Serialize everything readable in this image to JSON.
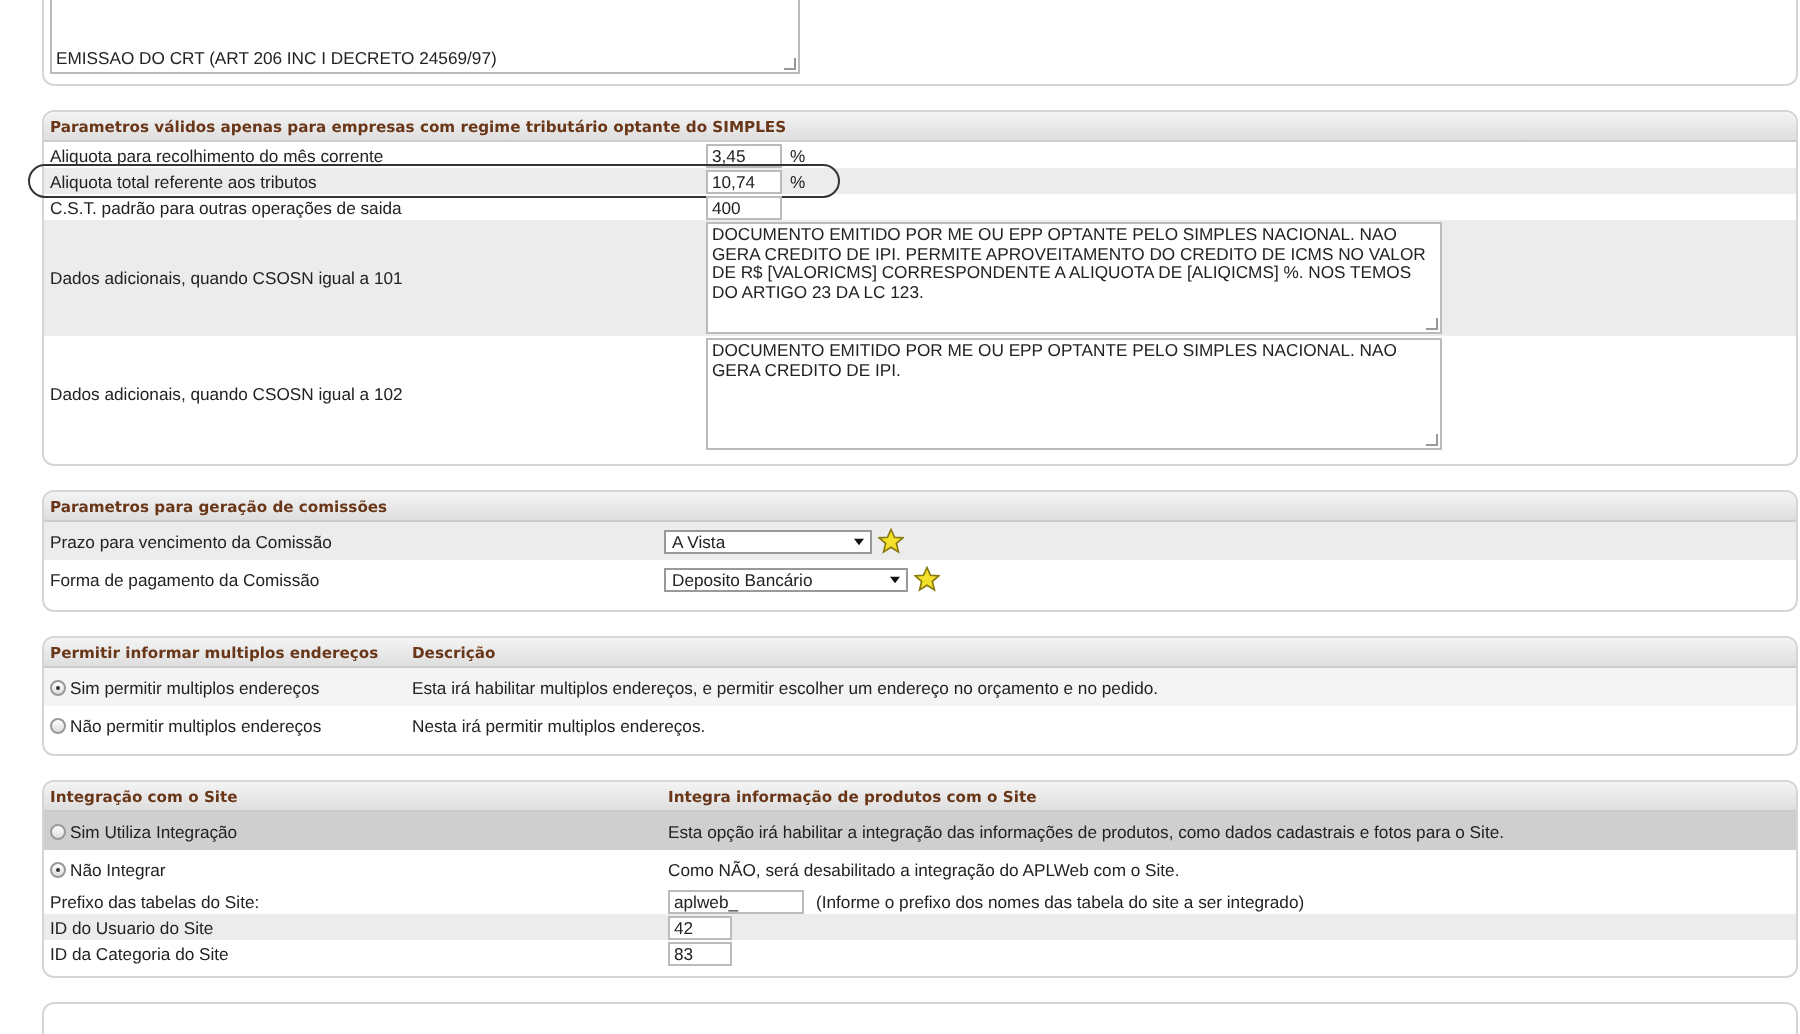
{
  "top_panel": {
    "textarea_value": "EMISSAO DO CRT (ART 206 INC I DECRETO 24569/97)"
  },
  "simples": {
    "title": "Parametros válidos apenas para empresas com regime tributário optante do SIMPLES",
    "rows": [
      {
        "kind": "input",
        "label": "Aliquota para recolhimento do mês corrente",
        "value": "3,45",
        "unit": "%",
        "circled": false
      },
      {
        "kind": "input",
        "label": "Aliquota total referente aos tributos",
        "value": "10,74",
        "unit": "%",
        "circled": true
      },
      {
        "kind": "input",
        "label": "C.S.T. padrão para outras operações de saida",
        "value": "400",
        "circled": false
      },
      {
        "kind": "textarea",
        "label": "Dados adicionais, quando CSOSN igual a 101",
        "value": "DOCUMENTO EMITIDO POR ME OU EPP OPTANTE PELO SIMPLES NACIONAL. NAO GERA CREDITO DE IPI. PERMITE APROVEITAMENTO DO CREDITO DE ICMS NO VALOR DE R$ [VALORICMS] CORRESPONDENTE A ALIQUOTA DE [ALIQICMS] %. NOS TEMOS DO ARTIGO 23 DA LC 123.",
        "circled": false
      },
      {
        "kind": "textarea",
        "label": "Dados adicionais, quando CSOSN igual a 102",
        "value": "DOCUMENTO EMITIDO POR ME OU EPP OPTANTE PELO SIMPLES NACIONAL. NAO GERA CREDITO DE IPI.",
        "circled": false
      }
    ]
  },
  "comissoes": {
    "title": "Parametros para geração de comissões",
    "rows": [
      {
        "label": "Prazo para vencimento da Comissão",
        "value": "A Vista"
      },
      {
        "label": "Forma de pagamento da Comissão",
        "value": "Deposito Bancário"
      }
    ]
  },
  "enderecos": {
    "columns": [
      "Permitir informar multiplos endereços",
      "Descrição"
    ],
    "options": [
      {
        "label": "Sim permitir multiplos endereços",
        "description": "Esta irá habilitar multiplos endereços, e permitir escolher um endereço no orçamento e no pedido.",
        "selected": true
      },
      {
        "label": "Não permitir multiplos endereços",
        "description": "Nesta irá permitir multiplos endereços.",
        "selected": false
      }
    ]
  },
  "site": {
    "columns": [
      "Integração com o Site",
      "Integra informação de produtos com o Site"
    ],
    "options": [
      {
        "label": "Sim Utiliza Integração",
        "description": "Esta opção irá habilitar a integração das informações de produtos, como dados cadastrais e fotos para o Site.",
        "selected": false
      },
      {
        "label": "Não Integrar",
        "description": "Como NÃO, será desabilitado a integração do APLWeb com o Site.",
        "selected": true
      }
    ],
    "fields": [
      {
        "label": "Prefixo das tabelas do Site:",
        "value": "aplweb_",
        "hint": "(Informe o prefixo dos nomes das tabela do site a ser integrado)"
      },
      {
        "label": "ID do Usuario do Site",
        "value": "42"
      },
      {
        "label": "ID da Categoria do Site",
        "value": "83"
      }
    ]
  }
}
